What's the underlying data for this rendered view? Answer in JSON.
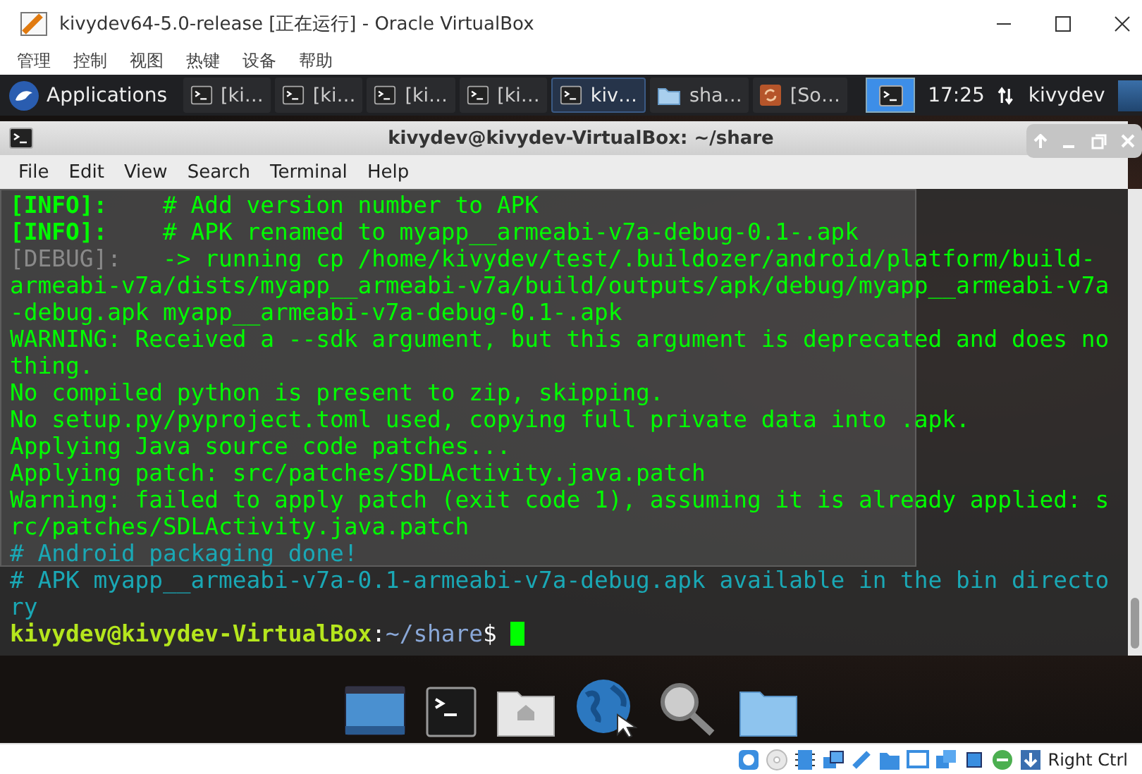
{
  "window": {
    "title": "kivydev64-5.0-release [正在运行] - Oracle VirtualBox"
  },
  "menu": [
    "管理",
    "控制",
    "视图",
    "热键",
    "设备",
    "帮助"
  ],
  "panel": {
    "applications": "Applications",
    "tasks": [
      {
        "label": "[ki…",
        "kind": "terminal",
        "selected": false
      },
      {
        "label": "[ki…",
        "kind": "terminal",
        "selected": false
      },
      {
        "label": "[ki…",
        "kind": "terminal",
        "selected": false
      },
      {
        "label": "[ki…",
        "kind": "terminal",
        "selected": false
      },
      {
        "label": "kiv…",
        "kind": "terminal",
        "selected": true
      },
      {
        "label": "sha…",
        "kind": "folder",
        "selected": false
      },
      {
        "label": "[So…",
        "kind": "updater",
        "selected": false
      }
    ],
    "clock": "17:25",
    "user": "kivydev"
  },
  "terminal": {
    "title": "kivydev@kivydev-VirtualBox: ~/share",
    "menu": [
      "File",
      "Edit",
      "View",
      "Search",
      "Terminal",
      "Help"
    ],
    "lines": [
      {
        "kind": "info",
        "prefix": "[INFO]:",
        "text": "    # Add version number to APK"
      },
      {
        "kind": "info",
        "prefix": "[INFO]:",
        "text": "    # APK renamed to myapp__armeabi-v7a-debug-0.1-.apk"
      },
      {
        "kind": "debug",
        "prefix": "[DEBUG]:",
        "text": "   -> running cp /home/kivydev/test/.buildozer/android/platform/build-armeabi-v7a/dists/myapp__armeabi-v7a/build/outputs/apk/debug/myapp__armeabi-v7a-debug.apk myapp__armeabi-v7a-debug-0.1-.apk"
      },
      {
        "kind": "plain",
        "text": "WARNING: Received a --sdk argument, but this argument is deprecated and does nothing."
      },
      {
        "kind": "plain",
        "text": "No compiled python is present to zip, skipping."
      },
      {
        "kind": "plain",
        "text": "No setup.py/pyproject.toml used, copying full private data into .apk."
      },
      {
        "kind": "plain",
        "text": "Applying Java source code patches..."
      },
      {
        "kind": "plain",
        "text": "Applying patch: src/patches/SDLActivity.java.patch"
      },
      {
        "kind": "plain",
        "text": "Warning: failed to apply patch (exit code 1), assuming it is already applied: src/patches/SDLActivity.java.patch"
      },
      {
        "kind": "comment",
        "text": "# Android packaging done!"
      },
      {
        "kind": "comment",
        "text": "# APK myapp__armeabi-v7a-0.1-armeabi-v7a-debug.apk available in the bin directory"
      },
      {
        "kind": "prompt",
        "user_host": "kivydev@kivydev-VirtualBox",
        "separator": ":",
        "path": "~/share",
        "symbol": "$"
      }
    ]
  },
  "status_bar": {
    "host_key": "Right Ctrl"
  }
}
